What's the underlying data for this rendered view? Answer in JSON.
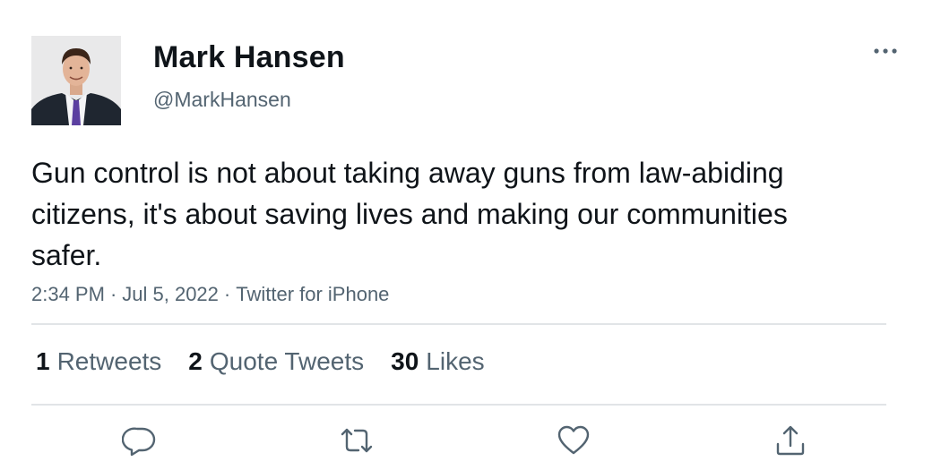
{
  "tweet": {
    "author": {
      "display_name": "Mark Hansen",
      "handle": "@MarkHansen"
    },
    "text": "Gun control is not about taking away guns from law-abiding citizens, it's about saving lives and making our communities safer.",
    "meta": {
      "time": "2:34 PM",
      "separator": "·",
      "date": "Jul 5, 2022",
      "source": "Twitter for iPhone"
    },
    "stats": {
      "retweets": {
        "count": "1",
        "label": "Retweets"
      },
      "quote_tweets": {
        "count": "2",
        "label": "Quote Tweets"
      },
      "likes": {
        "count": "30",
        "label": "Likes"
      }
    },
    "actions": [
      {
        "icon": "reply-icon"
      },
      {
        "icon": "retweet-icon"
      },
      {
        "icon": "like-icon"
      },
      {
        "icon": "share-icon"
      }
    ],
    "more_icon": "more-options-icon"
  },
  "colors": {
    "text_primary": "#0f1419",
    "text_secondary": "#536471",
    "divider": "#e1e4e7",
    "icon": "#536471"
  }
}
